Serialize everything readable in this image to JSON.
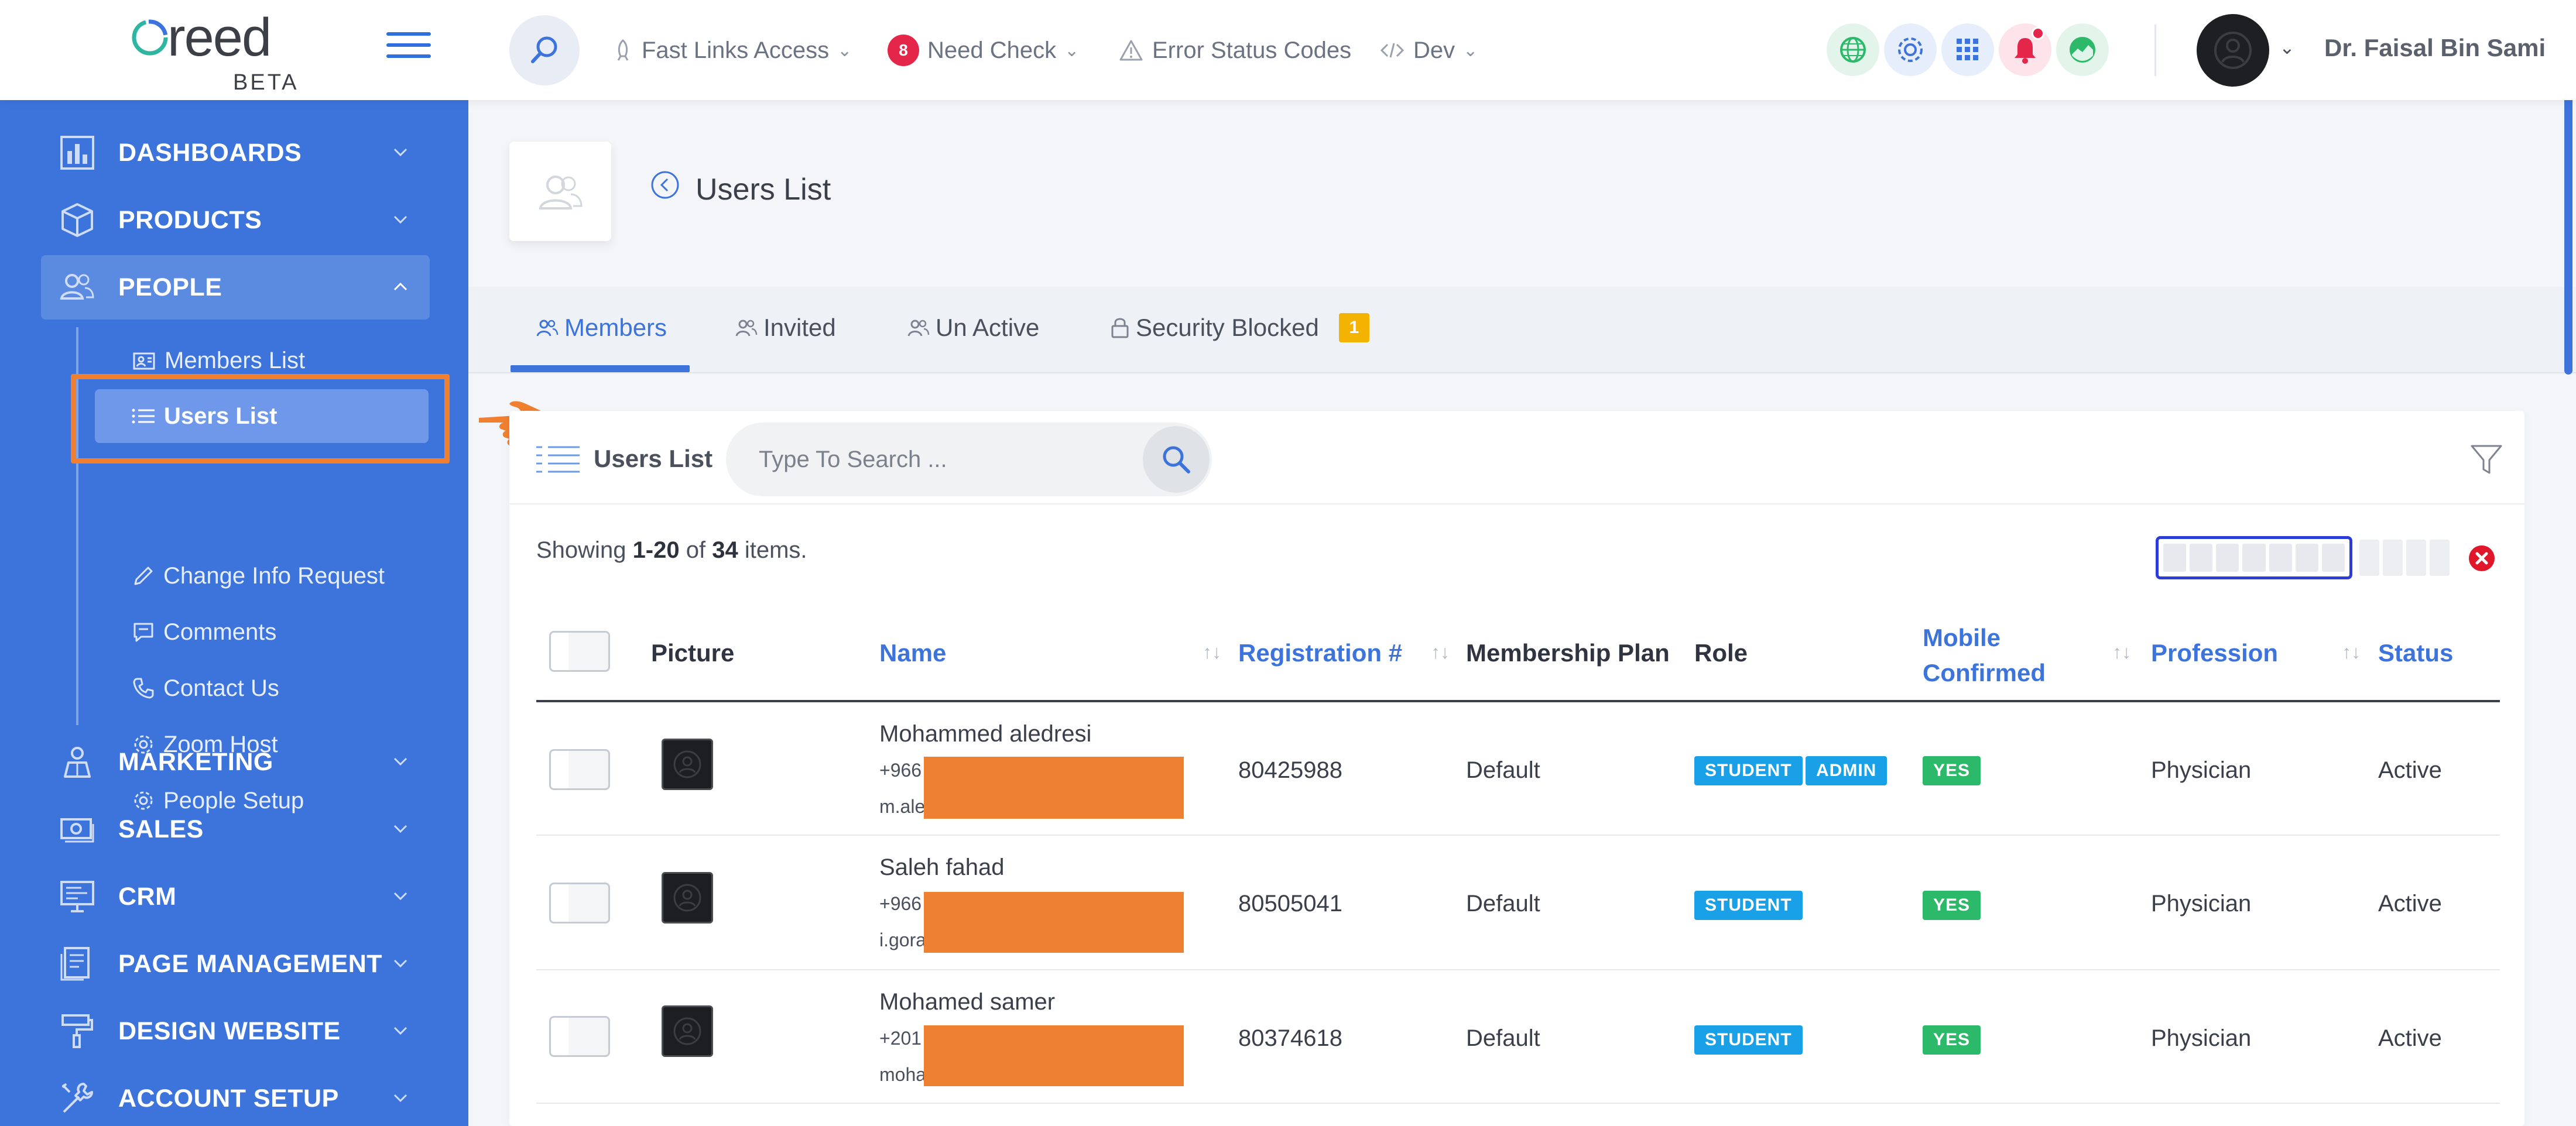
{
  "app": {
    "logo_text": "reed",
    "logo_beta": "BETA"
  },
  "topnav": {
    "fast_links": "Fast Links Access",
    "need_check_count": "8",
    "need_check": "Need Check",
    "error_codes": "Error Status Codes",
    "dev": "Dev",
    "user_name": "Dr. Faisal Bin Sami"
  },
  "sidebar": {
    "sections": [
      {
        "label": "DASHBOARDS"
      },
      {
        "label": "PRODUCTS"
      },
      {
        "label": "PEOPLE"
      },
      {
        "label": "MARKETING"
      },
      {
        "label": "SALES"
      },
      {
        "label": "CRM"
      },
      {
        "label": "PAGE MANAGEMENT"
      },
      {
        "label": "DESIGN WEBSITE"
      },
      {
        "label": "ACCOUNT SETUP"
      }
    ],
    "people_items": [
      {
        "label": "Members List"
      },
      {
        "label": "Users List"
      },
      {
        "label": "Change Info Request"
      },
      {
        "label": "Comments"
      },
      {
        "label": "Contact Us"
      },
      {
        "label": "Zoom Host"
      },
      {
        "label": "People Setup"
      }
    ]
  },
  "page": {
    "title": "Users List"
  },
  "tabs": [
    {
      "label": "Members"
    },
    {
      "label": "Invited"
    },
    {
      "label": "Un Active"
    },
    {
      "label": "Security Blocked",
      "badge": "1"
    }
  ],
  "card": {
    "title": "Users List",
    "search_placeholder": "Type To Search ...",
    "showing_prefix": "Showing",
    "showing_range": "1-20",
    "showing_of": "of",
    "showing_total": "34",
    "showing_suffix": "items."
  },
  "table": {
    "headers": {
      "picture": "Picture",
      "name": "Name",
      "registration": "Registration #",
      "membership": "Membership Plan",
      "role": "Role",
      "mobile_line1": "Mobile",
      "mobile_line2": "Confirmed",
      "profession": "Profession",
      "status": "Status"
    },
    "rows": [
      {
        "name": "Mohammed aledresi",
        "phone": "+966",
        "email": "m.ale",
        "registration": "80425988",
        "plan": "Default",
        "roles": [
          "STUDENT",
          "ADMIN"
        ],
        "mobile": "YES",
        "profession": "Physician",
        "status": "Active"
      },
      {
        "name": "Saleh fahad",
        "phone": "+966",
        "email": "i.gora",
        "registration": "80505041",
        "plan": "Default",
        "roles": [
          "STUDENT"
        ],
        "mobile": "YES",
        "profession": "Physician",
        "status": "Active"
      },
      {
        "name": "Mohamed samer",
        "phone": "+201",
        "email": "moha",
        "registration": "80374618",
        "plan": "Default",
        "roles": [
          "STUDENT"
        ],
        "mobile": "YES",
        "profession": "Physician",
        "status": "Active"
      }
    ]
  },
  "colors": {
    "sidebar": "#3c74dc",
    "accent": "#3c74dc",
    "highlight": "#f07f2f",
    "badge_red": "#e4264b",
    "role_pill": "#1aa0e6",
    "yes_pill": "#2cba6a"
  }
}
